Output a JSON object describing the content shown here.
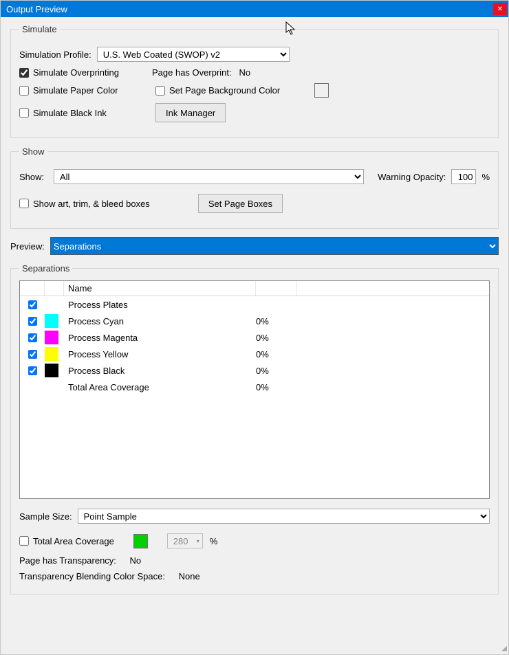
{
  "title": "Output Preview",
  "simulate": {
    "legend": "Simulate",
    "profile_label": "Simulation Profile:",
    "profile_value": "U.S. Web Coated (SWOP) v2",
    "overprint_label": "Simulate Overprinting",
    "overprint_checked": true,
    "page_has_overprint_label": "Page has Overprint:",
    "page_has_overprint_value": "No",
    "paper_color_label": "Simulate Paper Color",
    "set_bg_label": "Set Page Background Color",
    "black_ink_label": "Simulate Black Ink",
    "ink_manager_btn": "Ink Manager"
  },
  "show": {
    "legend": "Show",
    "show_label": "Show:",
    "show_value": "All",
    "warning_opacity_label": "Warning Opacity:",
    "warning_opacity_value": "100",
    "percent": "%",
    "art_boxes_label": "Show art, trim, & bleed boxes",
    "set_page_boxes_btn": "Set Page Boxes"
  },
  "preview": {
    "label": "Preview:",
    "value": "Separations"
  },
  "separations": {
    "legend": "Separations",
    "name_header": "Name",
    "rows": {
      "plates": {
        "name": "Process Plates"
      },
      "cyan": {
        "name": "Process Cyan",
        "pct": "0%",
        "color": "#00ffff"
      },
      "magenta": {
        "name": "Process Magenta",
        "pct": "0%",
        "color": "#ff00ff"
      },
      "yellow": {
        "name": "Process Yellow",
        "pct": "0%",
        "color": "#ffff00"
      },
      "black": {
        "name": "Process Black",
        "pct": "0%",
        "color": "#000000"
      },
      "total": {
        "name": "Total Area Coverage",
        "pct": "0%"
      }
    },
    "sample_size_label": "Sample Size:",
    "sample_size_value": "Point Sample",
    "total_area_label": "Total Area Coverage",
    "total_area_value": "280",
    "percent": "%",
    "page_transparency_label": "Page has Transparency:",
    "page_transparency_value": "No",
    "blend_space_label": "Transparency Blending Color Space:",
    "blend_space_value": "None"
  }
}
